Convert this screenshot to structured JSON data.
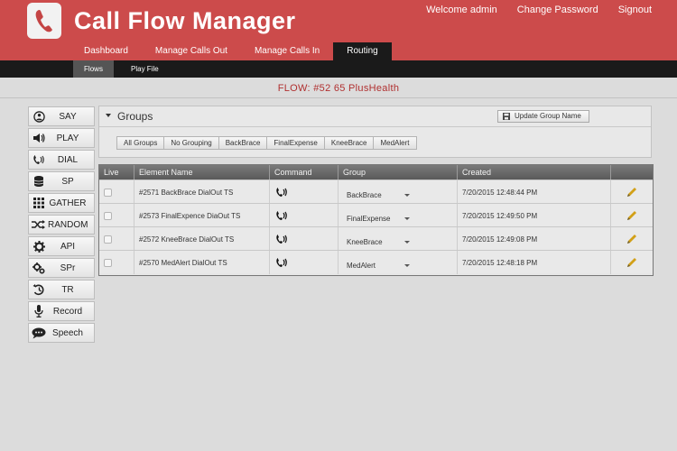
{
  "header": {
    "app_title": "Call Flow Manager",
    "top_links": {
      "welcome": "Welcome admin",
      "change_password": "Change Password",
      "signout": "Signout"
    },
    "tabs": [
      {
        "label": "Dashboard"
      },
      {
        "label": "Manage Calls Out"
      },
      {
        "label": "Manage Calls In"
      },
      {
        "label": "Routing",
        "active": true
      }
    ]
  },
  "subnav": {
    "items": [
      {
        "label": "Flows",
        "active": true
      },
      {
        "label": "Play File"
      }
    ]
  },
  "flow_title": "FLOW: #52 65 PlusHealth",
  "sidebar": {
    "items": [
      {
        "label": "SAY",
        "icon": "say-icon"
      },
      {
        "label": "PLAY",
        "icon": "speaker-icon"
      },
      {
        "label": "DIAL",
        "icon": "phone-icon"
      },
      {
        "label": "SP",
        "icon": "sp-icon"
      },
      {
        "label": "GATHER",
        "icon": "gather-icon"
      },
      {
        "label": "RANDOM",
        "icon": "shuffle-icon"
      },
      {
        "label": "API",
        "icon": "gear-icon"
      },
      {
        "label": "SPr",
        "icon": "gears-icon"
      },
      {
        "label": "TR",
        "icon": "history-icon"
      },
      {
        "label": "Record",
        "icon": "microphone-icon"
      },
      {
        "label": "Speech",
        "icon": "speech-bubble-icon"
      }
    ]
  },
  "groups": {
    "title": "Groups",
    "update_button": "Update Group Name",
    "filters": [
      "All Groups",
      "No Grouping",
      "BackBrace",
      "FinalExpense",
      "KneeBrace",
      "MedAlert"
    ]
  },
  "table": {
    "columns": [
      "Live",
      "Element Name",
      "Command",
      "Group",
      "Created"
    ],
    "rows": [
      {
        "name": "#2571 BackBrace DialOut TS",
        "command_icon": "phone-icon",
        "group": "BackBrace",
        "created": "7/20/2015 12:48:44 PM"
      },
      {
        "name": "#2573 FinalExpence DiaOut TS",
        "command_icon": "phone-icon",
        "group": "FinalExpense",
        "created": "7/20/2015 12:49:50 PM"
      },
      {
        "name": "#2572 KneeBrace DialOut TS",
        "command_icon": "phone-icon",
        "group": "KneeBrace",
        "created": "7/20/2015 12:49:08 PM"
      },
      {
        "name": "#2570 MedAlert DialOut TS",
        "command_icon": "phone-icon",
        "group": "MedAlert",
        "created": "7/20/2015 12:48:18 PM"
      }
    ]
  },
  "colors": {
    "header_red": "#cc4b4b",
    "nav_dark": "#1a1a1a",
    "flow_title_red": "#b03030",
    "edit_pencil": "#d2a017"
  }
}
